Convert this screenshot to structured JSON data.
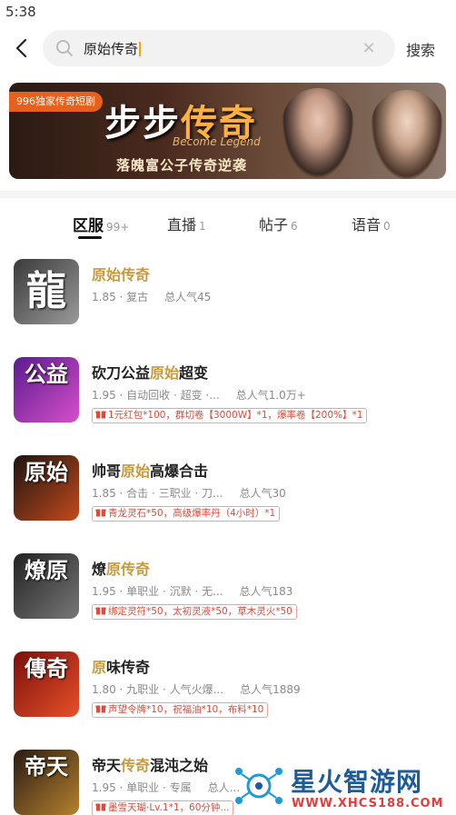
{
  "status_bar": {
    "time": "5:38"
  },
  "search": {
    "query": "原始传奇",
    "button_label": "搜索",
    "clear_symbol": "×"
  },
  "banner": {
    "tag": "996独家传奇短剧",
    "title_a": "步步",
    "title_b": "传奇",
    "subtitle_en": "Become Legend",
    "subtitle": "落魄富公子传奇逆袭"
  },
  "tabs": [
    {
      "label": "区服",
      "count": "99+"
    },
    {
      "label": "直播",
      "count": "1"
    },
    {
      "label": "帖子",
      "count": "6"
    },
    {
      "label": "语音",
      "count": "0"
    }
  ],
  "games": [
    {
      "name_parts": [
        "",
        "原始传奇",
        ""
      ],
      "meta": "1.85 · 复古",
      "popularity": "总人气45",
      "gift": "",
      "thumb_text": "龍",
      "thumb_colors": [
        "#3a3a3a",
        "#9a9a9a"
      ]
    },
    {
      "name_parts": [
        "砍刀公益",
        "原始",
        "超变"
      ],
      "meta": "1.95 · 自动回收 · 超变 ·...",
      "popularity": "总人气1.0万+",
      "gift": "1元红包*100，群切卷【3000W】*1，爆率卷【200%】*1",
      "thumb_text": "公益",
      "thumb_colors": [
        "#5b1b8f",
        "#d64fc9"
      ]
    },
    {
      "name_parts": [
        "帅哥",
        "原始",
        "高爆合击"
      ],
      "meta": "1.85 · 合击 · 三职业 · 刀...",
      "popularity": "总人气30",
      "gift": "青龙灵石*50，高级爆率丹（4小时）*1",
      "thumb_text": "原始",
      "thumb_colors": [
        "#1c1410",
        "#c44a1c"
      ]
    },
    {
      "name_parts": [
        "燎",
        "原传奇",
        ""
      ],
      "meta": "1.95 · 单职业 · 沉默 · 无...",
      "popularity": "总人气183",
      "gift": "绑定灵符*50，太初灵液*50，草木灵火*50",
      "thumb_text": "燎原",
      "thumb_colors": [
        "#222222",
        "#777777"
      ]
    },
    {
      "name_parts": [
        "",
        "原",
        "味传奇"
      ],
      "meta": "1.80 · 九职业 · 人气火爆...",
      "popularity": "总人气1889",
      "gift": "声望令牌*10，祝福油*10，布料*10",
      "thumb_text": "傳奇",
      "thumb_colors": [
        "#7a0f0a",
        "#e8502a"
      ]
    },
    {
      "name_parts": [
        "帝天",
        "传奇",
        "混沌之始"
      ],
      "meta": "1.95 · 单职业 · 专属",
      "popularity": "总人...",
      "gift": "墨雪天瑚·Lv.1*1，60分钟...",
      "thumb_text": "帝天",
      "thumb_colors": [
        "#2a1a12",
        "#b5822e"
      ]
    }
  ],
  "watermark": {
    "name": "星火智游网",
    "url": "WWW.XHCS188.COM"
  }
}
